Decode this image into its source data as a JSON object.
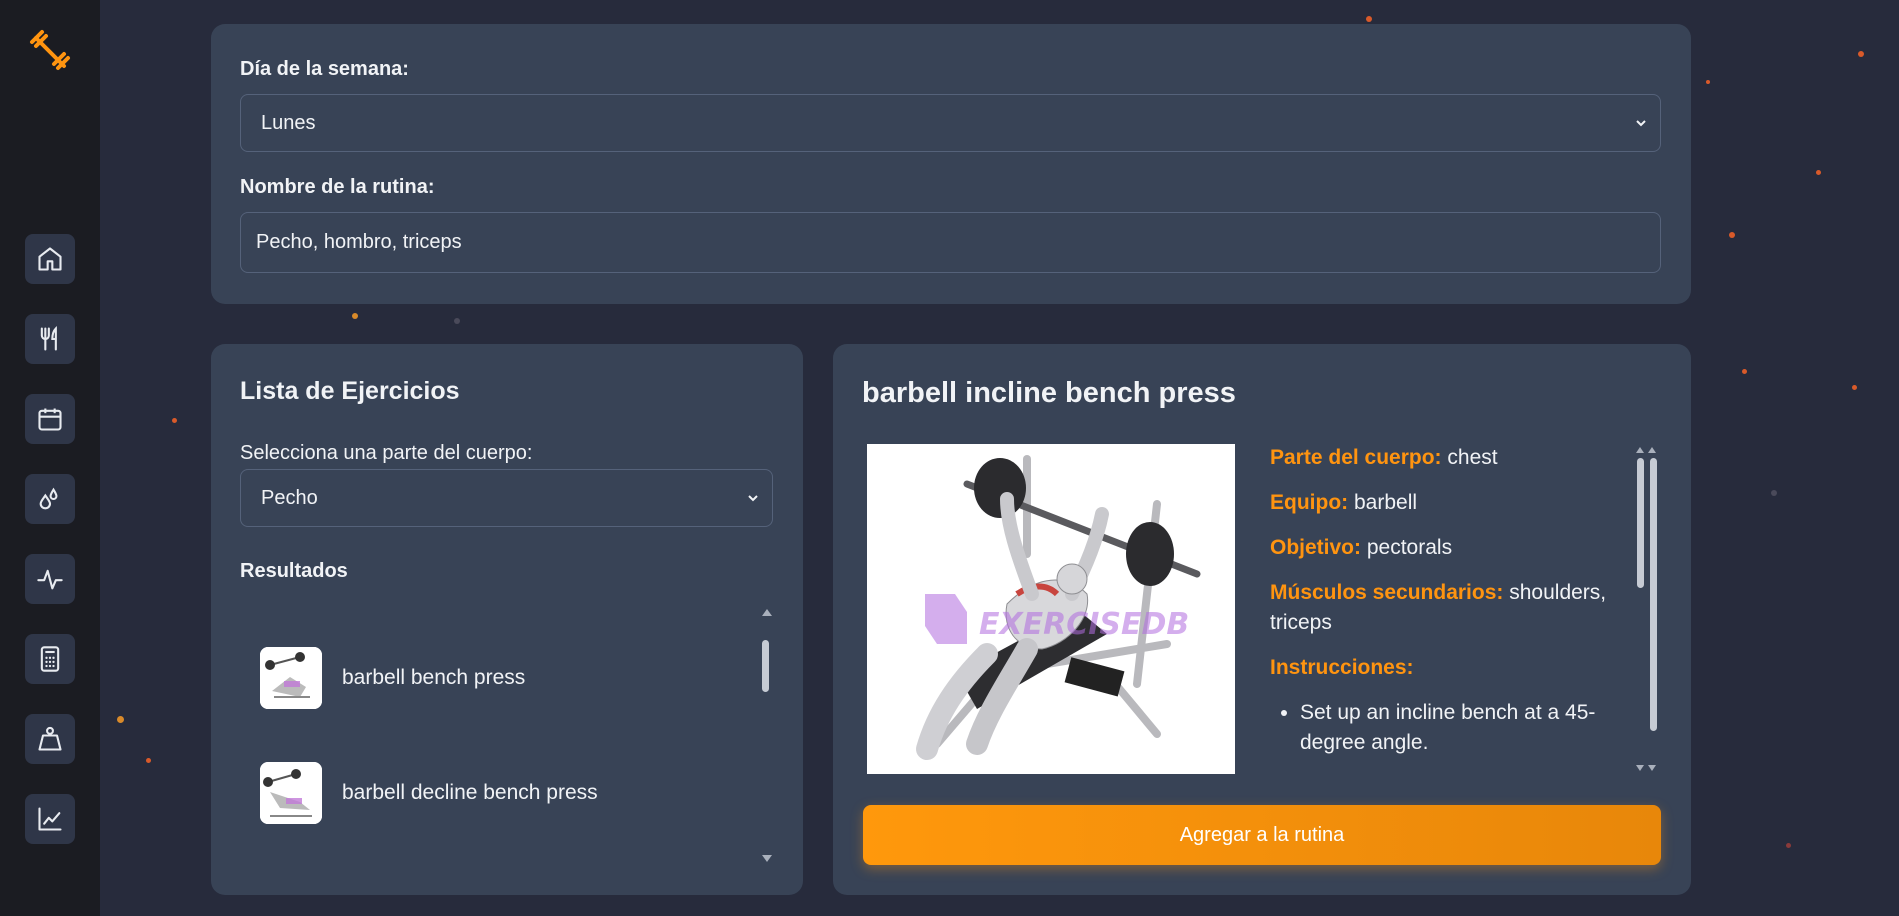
{
  "sidebar": {
    "logo_icon": "dumbbell-icon",
    "nav": [
      {
        "icon": "home-icon"
      },
      {
        "icon": "utensils-icon"
      },
      {
        "icon": "calendar-icon"
      },
      {
        "icon": "droplets-icon"
      },
      {
        "icon": "activity-icon"
      },
      {
        "icon": "calculator-icon"
      },
      {
        "icon": "weight-icon"
      },
      {
        "icon": "chart-line-icon"
      }
    ]
  },
  "routine_form": {
    "day_label": "Día de la semana:",
    "day_value": "Lunes",
    "name_label": "Nombre de la rutina:",
    "name_value": "Pecho, hombro, triceps"
  },
  "exercise_list": {
    "title": "Lista de Ejercicios",
    "body_part_label": "Selecciona una parte del cuerpo:",
    "body_part_value": "Pecho",
    "results_label": "Resultados",
    "results": [
      {
        "name": "barbell bench press"
      },
      {
        "name": "barbell decline bench press"
      }
    ]
  },
  "exercise_detail": {
    "title": "barbell incline bench press",
    "watermark": "EXERCISEDB",
    "body_part_key": "Parte del cuerpo:",
    "body_part_value": "chest",
    "equipment_key": "Equipo:",
    "equipment_value": "barbell",
    "target_key": "Objetivo:",
    "target_value": "pectorals",
    "secondary_key": "Músculos secundarios:",
    "secondary_value_line1": "shoulders,",
    "secondary_value_line2": "triceps",
    "instructions_key": "Instrucciones:",
    "instruction_1_line1": "Set up an incline bench at a 45-",
    "instruction_1_line2": "degree angle.",
    "add_button": "Agregar a la rutina"
  },
  "colors": {
    "accent": "#ff9410",
    "card": "#384356",
    "background": "#272b3c",
    "sidebar": "#1b1c22"
  }
}
